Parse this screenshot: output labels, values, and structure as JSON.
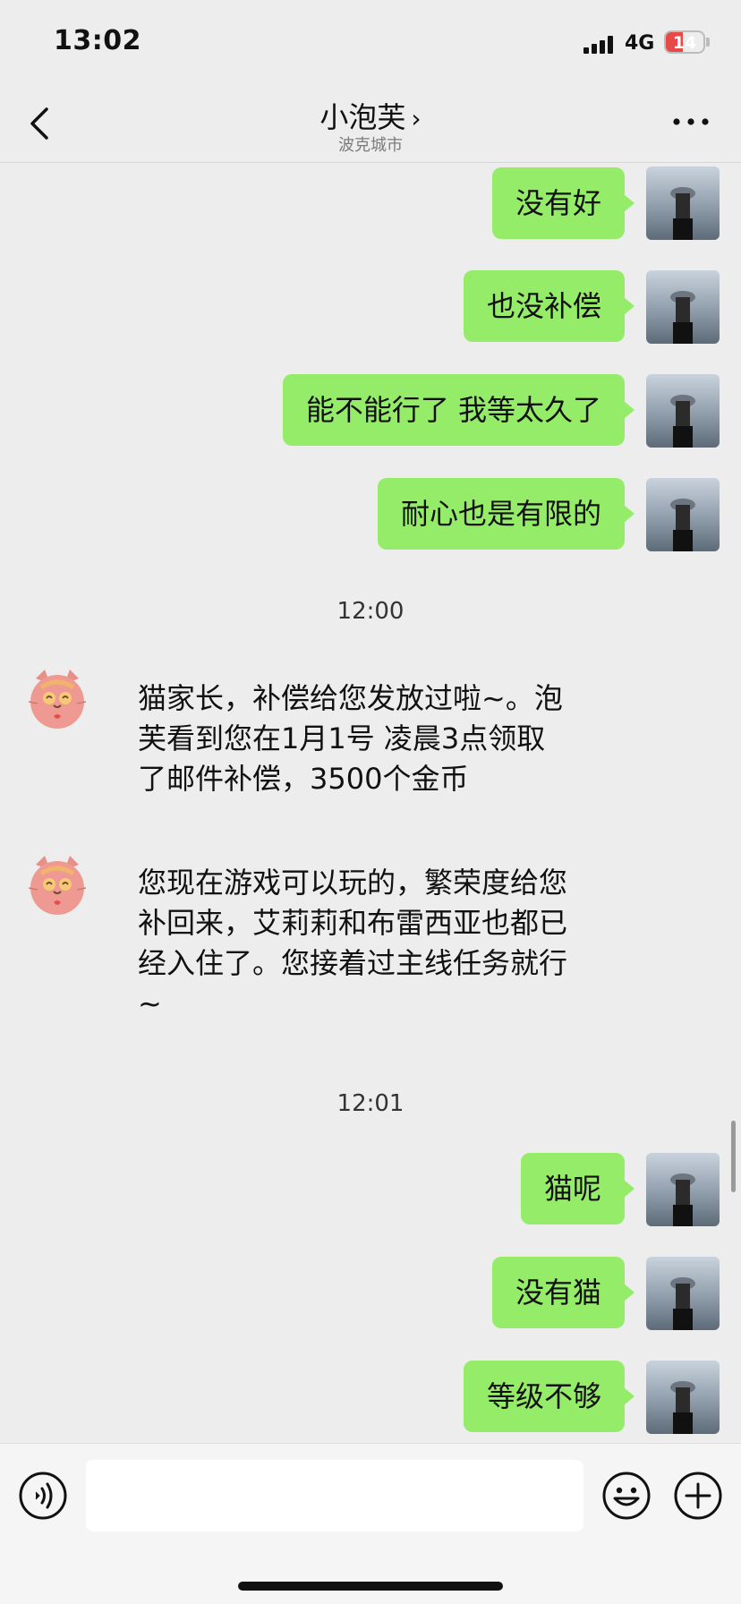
{
  "status_bar": {
    "time": "13:02",
    "network": "4G",
    "battery": "14",
    "battery_level": 0.14
  },
  "header": {
    "title": "小泡芙",
    "subtitle": "波克城市",
    "chevron": "›"
  },
  "messages": [
    {
      "text": "没有好"
    },
    {
      "text": "也没补偿"
    },
    {
      "text": "能不能行了 我等太久了"
    },
    {
      "text": "耐心也是有限的"
    }
  ],
  "timestamp_1": "12:00",
  "incoming": [
    {
      "lines": [
        "猫家长，补偿给您发放过啦~。泡",
        "芙看到您在1月1号 凌晨3点领取",
        "了邮件补偿，3500个金币"
      ]
    },
    {
      "lines": [
        "您现在游戏可以玩的，繁荣度给您",
        "补回来，艾莉莉和布雷西亚也都已",
        "经入住了。您接着过主线任务就行",
        "~"
      ]
    }
  ],
  "timestamp_2": "12:01",
  "messages_2": [
    {
      "text": "猫呢"
    },
    {
      "text": "没有猫"
    },
    {
      "text": "等级不够"
    }
  ],
  "input": {
    "value": "",
    "placeholder": ""
  },
  "icons": {
    "back": "back-chevron-icon",
    "more": "more-dots-icon",
    "voice": "voice-icon",
    "emoji": "emoji-icon",
    "plus": "plus-icon"
  },
  "colors": {
    "outgoing_bubble": "#95ec69",
    "background": "#ededed",
    "battery_low": "#e84848"
  }
}
